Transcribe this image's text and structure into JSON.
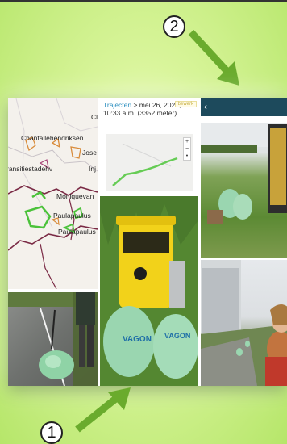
{
  "callouts": {
    "one": "1",
    "two": "2"
  },
  "map": {
    "labels": [
      "Chantallehendriksen",
      "Jose",
      "ransitiestadehv",
      "Inj",
      "Moniquevan",
      "Paulapaulus",
      "Paulapaulus",
      "Cl"
    ]
  },
  "traject": {
    "breadcrumb_link": "Trajecten",
    "breadcrumb_rest": " > mei 26, 2021, 10:33 a.m. (3352 meter)",
    "badge": "bewerk",
    "zoom_in": "+",
    "zoom_out": "−",
    "zoom_dot": "•"
  },
  "phone": {
    "back_glyph": "‹"
  },
  "bag_text": "VAGON",
  "colors": {
    "bg": "#d9f59b",
    "arrow": "#6aab2d",
    "route": "#66cc55",
    "bin": "#f2d21a"
  },
  "icons": [
    "chevron-left-icon",
    "plus-icon",
    "minus-icon"
  ]
}
